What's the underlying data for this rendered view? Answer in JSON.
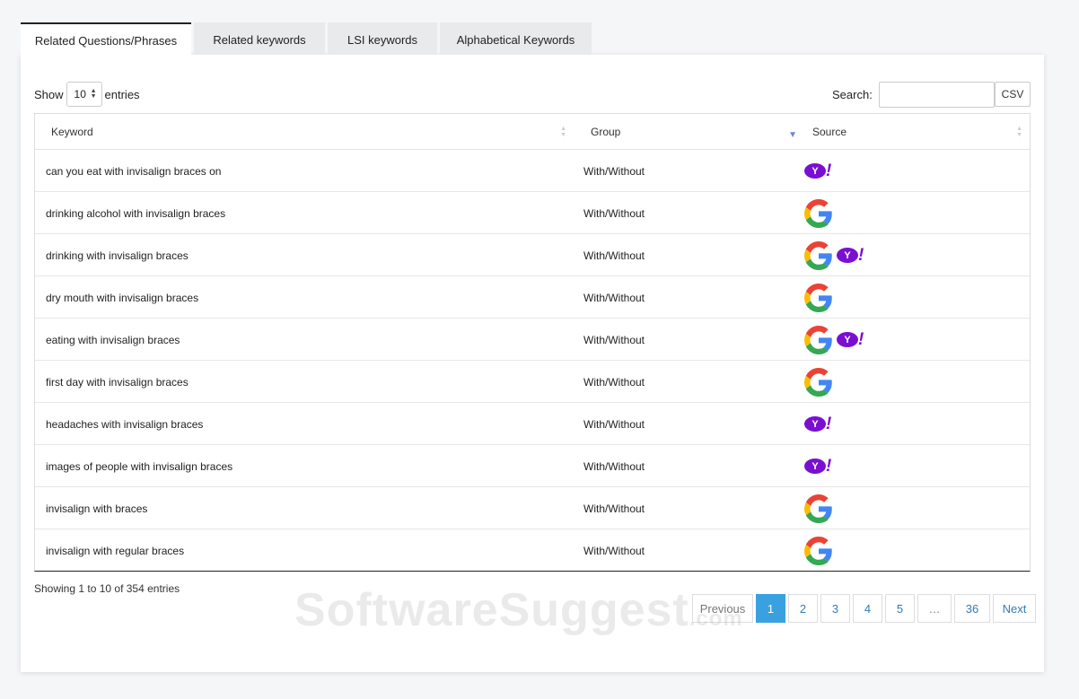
{
  "tabs": [
    {
      "label": "Related Questions/Phrases",
      "active": true
    },
    {
      "label": "Related keywords",
      "active": false
    },
    {
      "label": "LSI keywords",
      "active": false
    },
    {
      "label": "Alphabetical Keywords",
      "active": false
    }
  ],
  "controls": {
    "show_label": "Show",
    "entries_value": "10",
    "entries_label": "entries",
    "search_label": "Search:",
    "search_value": "",
    "csv_label": "CSV"
  },
  "table": {
    "columns": [
      "Keyword",
      "Group",
      "Source"
    ],
    "rows": [
      {
        "keyword": "can you eat with invisalign braces on",
        "group": "With/Without",
        "sources": [
          "yahoo-icon"
        ]
      },
      {
        "keyword": "drinking alcohol with invisalign braces",
        "group": "With/Without",
        "sources": [
          "google-icon"
        ]
      },
      {
        "keyword": "drinking with invisalign braces",
        "group": "With/Without",
        "sources": [
          "google-icon",
          "yahoo-icon"
        ]
      },
      {
        "keyword": "dry mouth with invisalign braces",
        "group": "With/Without",
        "sources": [
          "google-icon"
        ]
      },
      {
        "keyword": "eating with invisalign braces",
        "group": "With/Without",
        "sources": [
          "google-icon",
          "yahoo-icon"
        ]
      },
      {
        "keyword": "first day with invisalign braces",
        "group": "With/Without",
        "sources": [
          "google-icon"
        ]
      },
      {
        "keyword": "headaches with invisalign braces",
        "group": "With/Without",
        "sources": [
          "yahoo-icon"
        ]
      },
      {
        "keyword": "images of people with invisalign braces",
        "group": "With/Without",
        "sources": [
          "yahoo-icon"
        ]
      },
      {
        "keyword": "invisalign with braces",
        "group": "With/Without",
        "sources": [
          "google-icon"
        ]
      },
      {
        "keyword": "invisalign with regular braces",
        "group": "With/Without",
        "sources": [
          "google-icon"
        ]
      }
    ]
  },
  "info": "Showing 1 to 10 of 354 entries",
  "pagination": {
    "previous": "Previous",
    "pages": [
      "1",
      "2",
      "3",
      "4",
      "5"
    ],
    "active": "1",
    "ellipsis": "…",
    "last": "36",
    "next": "Next"
  },
  "watermark": {
    "main": "SoftwareSuggest",
    "suffix": ".com"
  },
  "colors": {
    "accent": "#3aa1e0",
    "yahoo": "#7b0fd1",
    "sort_active": "#6f86d6",
    "link": "#337ab7"
  }
}
